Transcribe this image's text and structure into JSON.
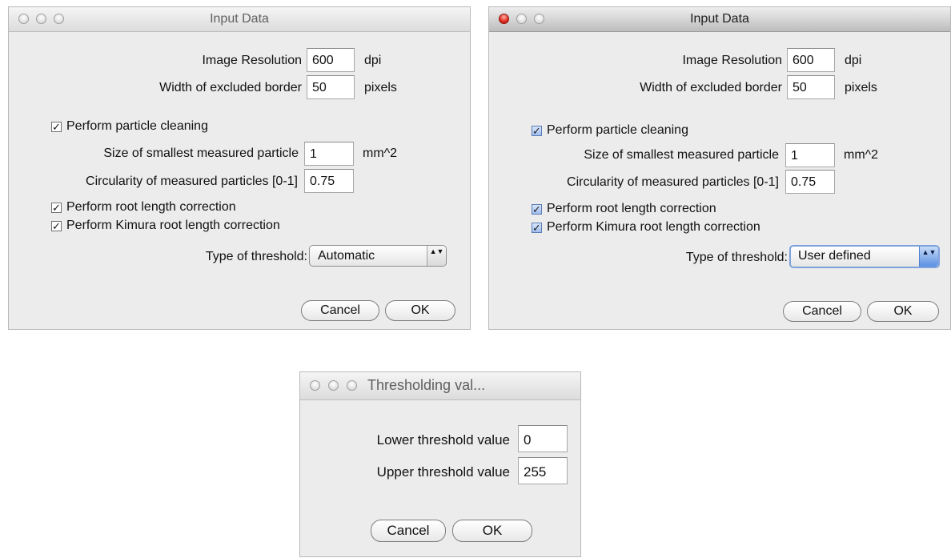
{
  "dialog_left": {
    "title": "Input Data",
    "image_resolution": {
      "label": "Image Resolution",
      "value": "600",
      "unit": "dpi"
    },
    "excluded_border": {
      "label": "Width of excluded border",
      "value": "50",
      "unit": "pixels"
    },
    "particle_cleaning": {
      "label": "Perform particle cleaning",
      "checked": true
    },
    "smallest_particle": {
      "label": "Size of smallest measured particle",
      "value": "1",
      "unit": "mm^2"
    },
    "circularity": {
      "label": "Circularity of measured particles [0-1]",
      "value": "0.75"
    },
    "root_length": {
      "label": "Perform root length correction",
      "checked": true
    },
    "kimura": {
      "label": "Perform Kimura root length correction",
      "checked": true
    },
    "threshold_type": {
      "label": "Type of threshold:",
      "value": "Automatic"
    },
    "cancel_label": "Cancel",
    "ok_label": "OK"
  },
  "dialog_right": {
    "title": "Input Data",
    "image_resolution": {
      "label": "Image Resolution",
      "value": "600",
      "unit": "dpi"
    },
    "excluded_border": {
      "label": "Width of excluded border",
      "value": "50",
      "unit": "pixels"
    },
    "particle_cleaning": {
      "label": "Perform particle cleaning",
      "checked": true
    },
    "smallest_particle": {
      "label": "Size of smallest measured particle",
      "value": "1",
      "unit": "mm^2"
    },
    "circularity": {
      "label": "Circularity of measured particles [0-1]",
      "value": "0.75"
    },
    "root_length": {
      "label": "Perform root length correction",
      "checked": true
    },
    "kimura": {
      "label": "Perform Kimura root length correction",
      "checked": true
    },
    "threshold_type": {
      "label": "Type of threshold:",
      "value": "User defined"
    },
    "cancel_label": "Cancel",
    "ok_label": "OK"
  },
  "dialog_threshold": {
    "title": "Thresholding val...",
    "lower": {
      "label": "Lower threshold value",
      "value": "0"
    },
    "upper": {
      "label": "Upper threshold value",
      "value": "255"
    },
    "cancel_label": "Cancel",
    "ok_label": "OK"
  },
  "icons": {
    "checkmark": "✓",
    "stepper": "▲▼"
  },
  "colors": {
    "window_bg": "#ececec",
    "close_red": "#e2271c",
    "focus_blue": "#7fa2dc"
  }
}
